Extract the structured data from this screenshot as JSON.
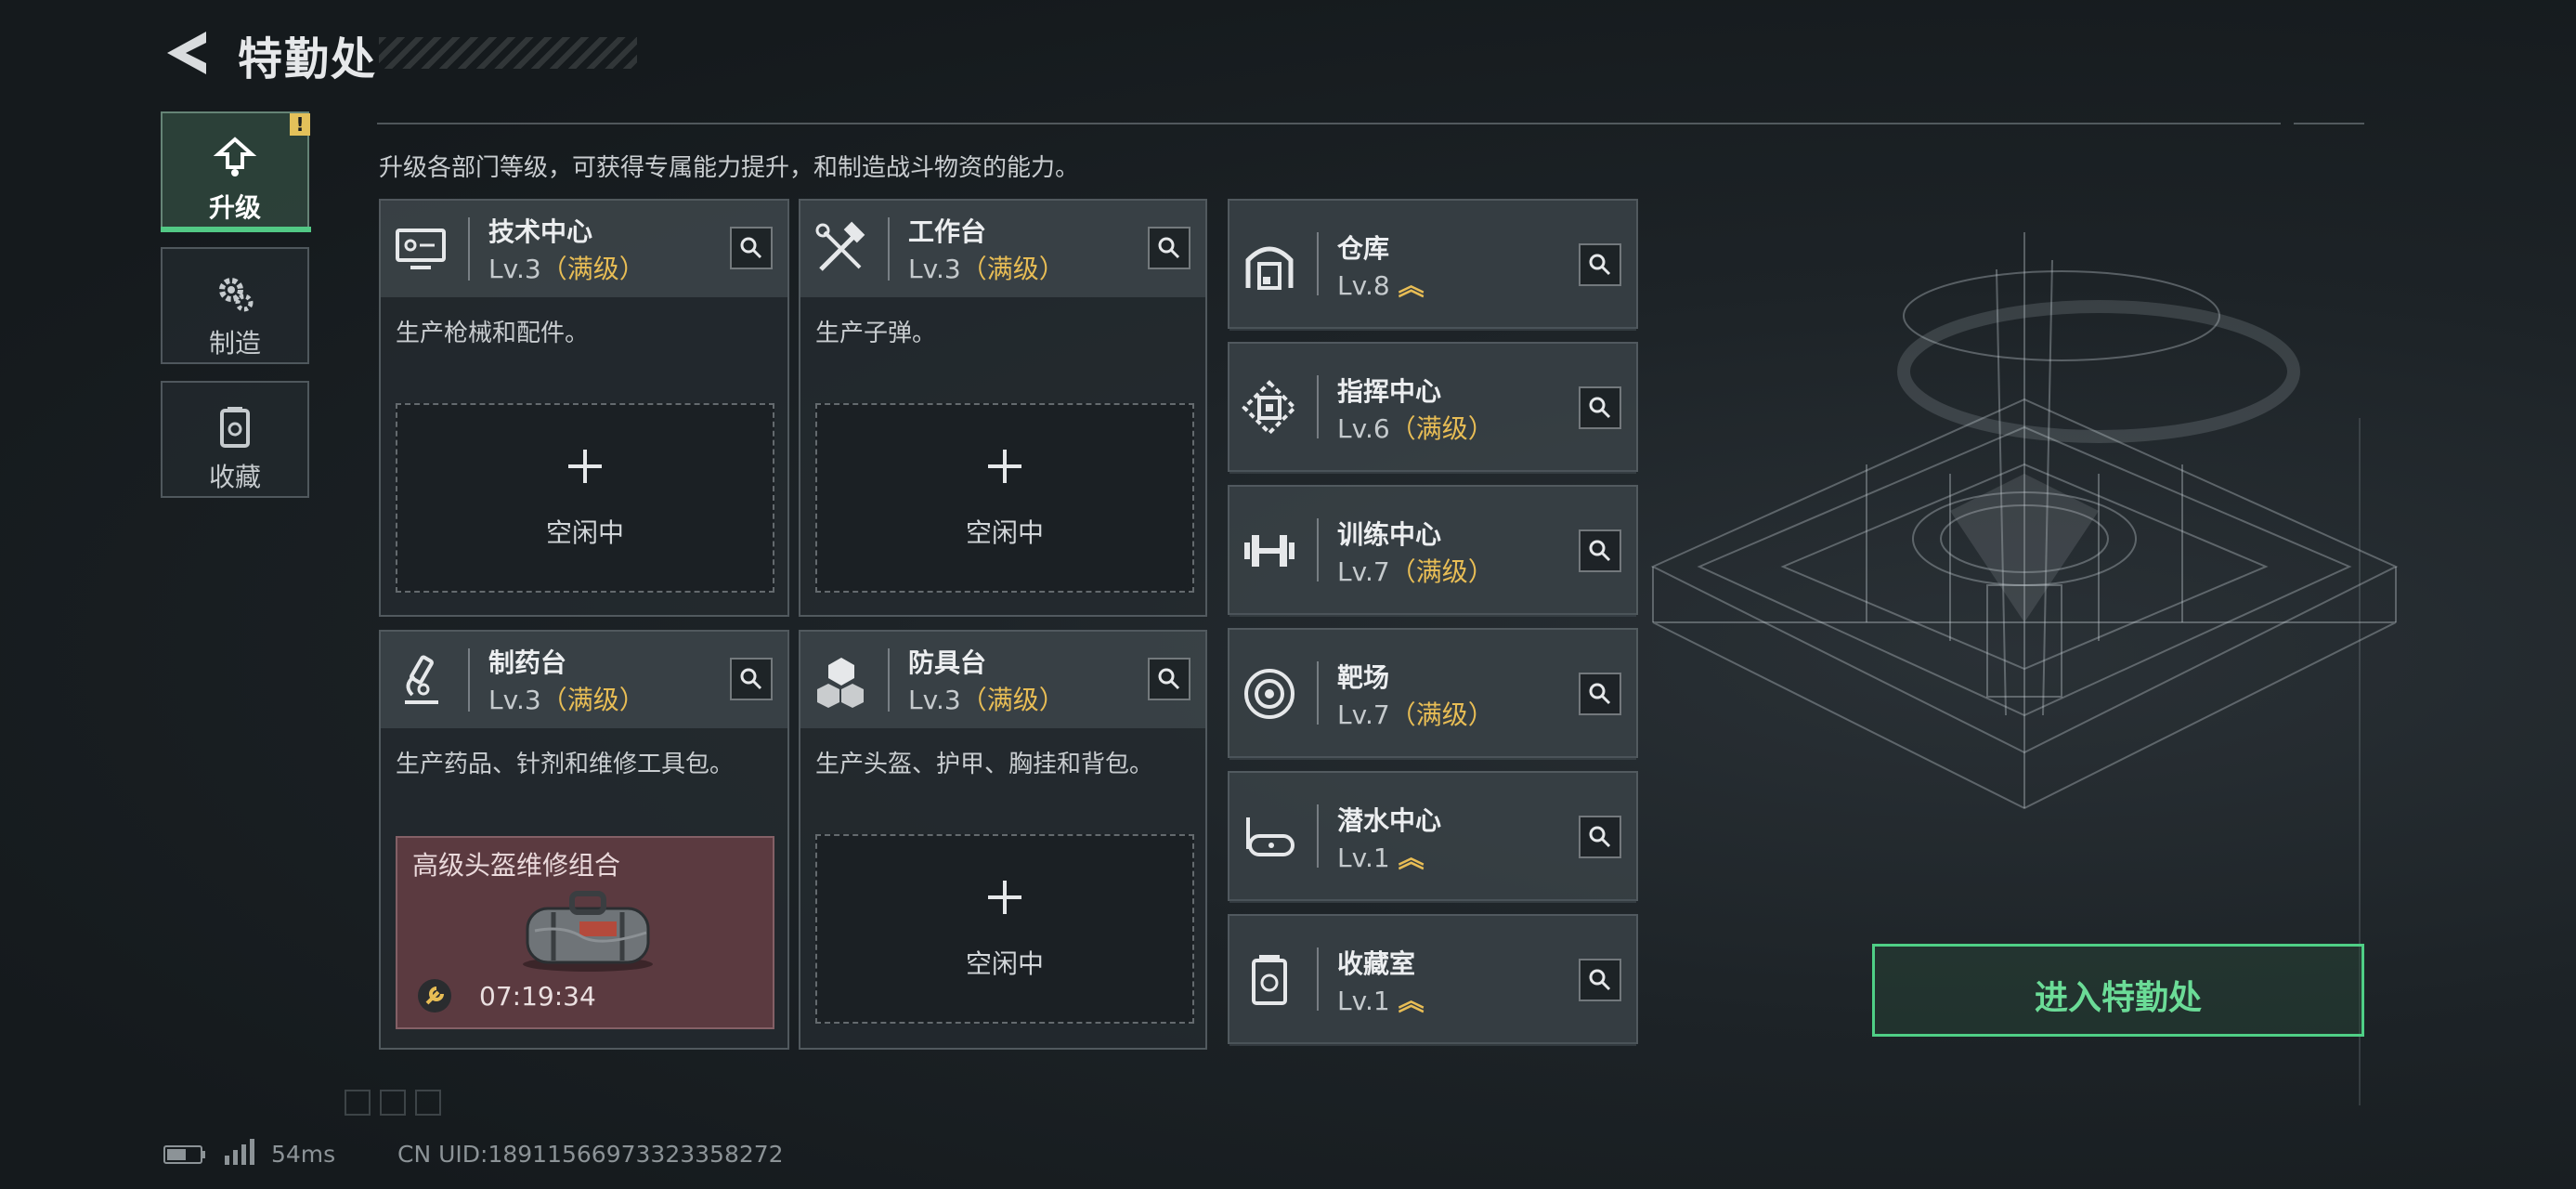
{
  "header": {
    "title": "特勤处"
  },
  "subtitle": "升级各部门等级，可获得专属能力提升，和制造战斗物资的能力。",
  "tabs": [
    {
      "label": "升级",
      "icon": "upgrade-icon",
      "active": true,
      "alert": "!"
    },
    {
      "label": "制造",
      "icon": "gear-icon",
      "active": false
    },
    {
      "label": "收藏",
      "icon": "collection-icon",
      "active": false
    }
  ],
  "facilities": [
    {
      "name": "技术中心",
      "level": "Lv.3",
      "status": "（满级）",
      "icon": "monitor-icon",
      "desc": "生产枪械和配件。",
      "slot": "空闲中"
    },
    {
      "name": "工作台",
      "level": "Lv.3",
      "status": "（满级）",
      "icon": "tools-icon",
      "desc": "生产子弹。",
      "slot": "空闲中"
    },
    {
      "name": "制药台",
      "level": "Lv.3",
      "status": "（满级）",
      "icon": "microscope-icon",
      "desc": "生产药品、针剂和维修工具包。",
      "craft": {
        "name": "高级头盔维修组合",
        "time": "07:19:34"
      }
    },
    {
      "name": "防具台",
      "level": "Lv.3",
      "status": "（满级）",
      "icon": "armor-icon",
      "desc": "生产头盔、护甲、胸挂和背包。",
      "slot": "空闲中"
    }
  ],
  "side_facilities": [
    {
      "name": "仓库",
      "level": "Lv.8",
      "status": "upgradable",
      "icon": "warehouse-icon"
    },
    {
      "name": "指挥中心",
      "level": "Lv.6",
      "status": "（满级）",
      "icon": "command-icon"
    },
    {
      "name": "训练中心",
      "level": "Lv.7",
      "status": "（满级）",
      "icon": "dumbbell-icon"
    },
    {
      "name": "靶场",
      "level": "Lv.7",
      "status": "（满级）",
      "icon": "target-icon"
    },
    {
      "name": "潜水中心",
      "level": "Lv.1",
      "status": "upgradable",
      "icon": "diving-mask-icon"
    },
    {
      "name": "收藏室",
      "level": "Lv.1",
      "status": "upgradable",
      "icon": "collection-icon"
    }
  ],
  "enter_button": "进入特勤处",
  "status_bar": {
    "ping": "54ms",
    "uid": "CN UID:18911566973323358272"
  },
  "colors": {
    "accent_green": "#4fcf86",
    "max_level_gold": "#e8bd55",
    "alert_yellow": "#e3c15a",
    "craft_bg": "#5b3a40"
  }
}
